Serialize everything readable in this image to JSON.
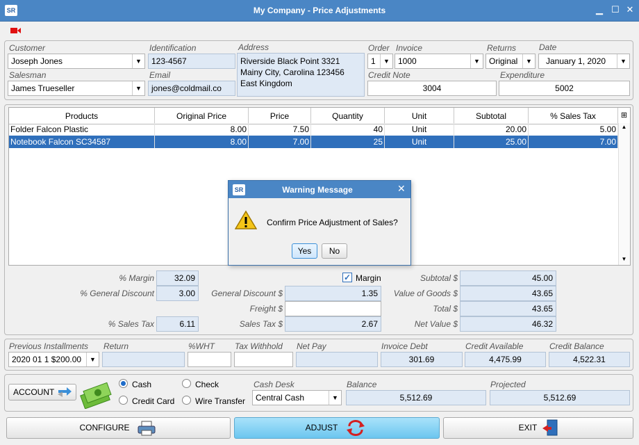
{
  "window": {
    "title": "My Company - Price Adjustments",
    "logo": "SR"
  },
  "header": {
    "customer_label": "Customer",
    "customer_value": "Joseph Jones",
    "identification_label": "Identification",
    "identification_value": "123-4567",
    "address_label": "Address",
    "address_lines": [
      "Riverside Black Point 3321",
      "Mainy City, Carolina 123456",
      "East Kingdom"
    ],
    "order_label": "Order",
    "order_value": "1",
    "invoice_label": "Invoice",
    "invoice_value": "1000",
    "returns_label": "Returns",
    "returns_value": "Original",
    "date_label": "Date",
    "date_value": "January 1, 2020",
    "salesman_label": "Salesman",
    "salesman_value": "James Trueseller",
    "email_label": "Email",
    "email_value": "jones@coldmail.co",
    "credit_note_label": "Credit Note",
    "credit_note_value": "3004",
    "expenditure_label": "Expenditure",
    "expenditure_value": "5002"
  },
  "table": {
    "columns": [
      "Products",
      "Original Price",
      "Price",
      "Quantity",
      "Unit",
      "Subtotal",
      "% Sales Tax"
    ],
    "rows": [
      [
        "Folder Falcon Plastic",
        "8.00",
        "7.50",
        "40",
        "Unit",
        "20.00",
        "5.00"
      ],
      [
        "Notebook Falcon SC34587",
        "8.00",
        "7.00",
        "25",
        "Unit",
        "25.00",
        "7.00"
      ]
    ]
  },
  "dialog": {
    "title": "Warning Message",
    "logo": "SR",
    "message": "Confirm Price Adjustment of Sales?",
    "yes": "Yes",
    "no": "No"
  },
  "totals": {
    "margin_pct_label": "% Margin",
    "margin_pct": "32.09",
    "general_discount_pct_label": "% General Discount",
    "general_discount_pct": "3.00",
    "sales_tax_pct_label": "% Sales Tax",
    "sales_tax_pct": "6.11",
    "margin_check_label": "Margin",
    "general_discount_label": "General Discount $",
    "general_discount": "1.35",
    "freight_label": "Freight $",
    "freight": "",
    "sales_tax_label": "Sales Tax $",
    "sales_tax": "2.67",
    "subtotal_label": "Subtotal $",
    "subtotal": "45.00",
    "value_goods_label": "Value of Goods $",
    "value_goods": "43.65",
    "total_label": "Total $",
    "total": "43.65",
    "net_value_label": "Net Value $",
    "net_value": "46.32"
  },
  "installments": {
    "prev_label": "Previous Installments",
    "prev_value": "2020 01 1 $200.00",
    "return_label": "Return",
    "return_value": "",
    "wht_label": "%WHT",
    "wht_value": "",
    "tax_withhold_label": "Tax Withhold",
    "tax_withhold_value": "",
    "net_pay_label": "Net Pay",
    "net_pay_value": "",
    "invoice_debt_label": "Invoice Debt",
    "invoice_debt_value": "301.69",
    "credit_available_label": "Credit Available",
    "credit_available_value": "4,475.99",
    "credit_balance_label": "Credit Balance",
    "credit_balance_value": "4,522.31"
  },
  "payment": {
    "account_label": "ACCOUNT",
    "cash": "Cash",
    "check": "Check",
    "credit_card": "Credit Card",
    "wire_transfer": "Wire Transfer",
    "cash_desk_label": "Cash Desk",
    "cash_desk_value": "Central Cash",
    "balance_label": "Balance",
    "balance_value": "5,512.69",
    "projected_label": "Projected",
    "projected_value": "5,512.69"
  },
  "footer": {
    "configure": "CONFIGURE",
    "adjust": "ADJUST",
    "exit": "EXIT"
  },
  "colors": {
    "titlebar": "#4a86c5",
    "selection": "#2f6fbb",
    "readonly": "#dfe9f5",
    "adjust": "#7fcdf0"
  }
}
